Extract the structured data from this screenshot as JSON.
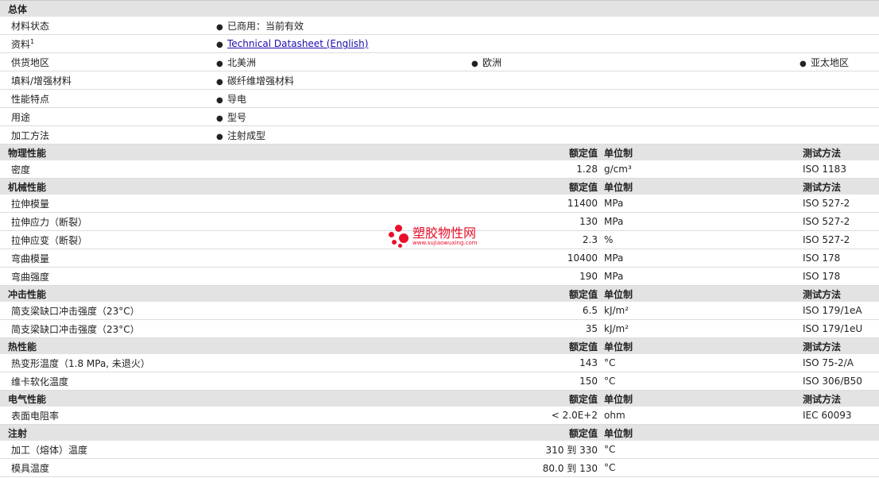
{
  "general": {
    "title": "总体",
    "rows": [
      {
        "label": "材料状态",
        "items": [
          "已商用：当前有效"
        ]
      },
      {
        "label": "资料",
        "sup": "1",
        "items": [
          "Technical Datasheet (English)"
        ],
        "link": true
      },
      {
        "label": "供货地区",
        "items": [
          "北美洲",
          "欧洲",
          "亚太地区"
        ]
      },
      {
        "label": "填料/增强材料",
        "items": [
          "碳纤维增强材料"
        ]
      },
      {
        "label": "性能特点",
        "items": [
          "导电"
        ]
      },
      {
        "label": "用途",
        "items": [
          "型号"
        ]
      },
      {
        "label": "加工方法",
        "items": [
          "注射成型"
        ]
      }
    ]
  },
  "sections": [
    {
      "title": "物理性能",
      "h_value": "额定值",
      "h_unit": "单位制",
      "h_method": "测试方法",
      "rows": [
        {
          "label": "密度",
          "value": "1.28",
          "unit": "g/cm³",
          "method": "ISO 1183"
        }
      ]
    },
    {
      "title": "机械性能",
      "h_value": "额定值",
      "h_unit": "单位制",
      "h_method": "测试方法",
      "rows": [
        {
          "label": "拉伸模量",
          "value": "11400",
          "unit": "MPa",
          "method": "ISO 527-2"
        },
        {
          "label": "拉伸应力（断裂）",
          "value": "130",
          "unit": "MPa",
          "method": "ISO 527-2"
        },
        {
          "label": "拉伸应变（断裂）",
          "value": "2.3",
          "unit": "%",
          "method": "ISO 527-2"
        },
        {
          "label": "弯曲模量",
          "value": "10400",
          "unit": "MPa",
          "method": "ISO 178"
        },
        {
          "label": "弯曲强度",
          "value": "190",
          "unit": "MPa",
          "method": "ISO 178"
        }
      ]
    },
    {
      "title": "冲击性能",
      "h_value": "额定值",
      "h_unit": "单位制",
      "h_method": "测试方法",
      "rows": [
        {
          "label": "简支梁缺口冲击强度（23°C）",
          "value": "6.5",
          "unit": "kJ/m²",
          "method": "ISO 179/1eA"
        },
        {
          "label": "简支梁缺口冲击强度（23°C）",
          "value": "35",
          "unit": "kJ/m²",
          "method": "ISO 179/1eU"
        }
      ]
    },
    {
      "title": "热性能",
      "h_value": "额定值",
      "h_unit": "单位制",
      "h_method": "测试方法",
      "rows": [
        {
          "label": "热变形温度（1.8 MPa, 未退火）",
          "value": "143",
          "unit": "°C",
          "method": "ISO 75-2/A"
        },
        {
          "label": "维卡软化温度",
          "value": "150",
          "unit": "°C",
          "method": "ISO 306/B50"
        }
      ]
    },
    {
      "title": "电气性能",
      "h_value": "额定值",
      "h_unit": "单位制",
      "h_method": "测试方法",
      "rows": [
        {
          "label": "表面电阻率",
          "value": "< 2.0E+2",
          "unit": "ohm",
          "method": "IEC 60093"
        }
      ]
    },
    {
      "title": "注射",
      "h_value": "额定值",
      "h_unit": "单位制",
      "h_method": "",
      "rows": [
        {
          "label": "加工（熔体）温度",
          "value": "310 到  330",
          "unit": "°C",
          "method": ""
        },
        {
          "label": "模具温度",
          "value": "80.0 到  130",
          "unit": "°C",
          "method": ""
        }
      ]
    }
  ],
  "watermark": {
    "title": "塑胶物性网",
    "url": "www.sujiaowuxing.com",
    "color": "#e8102a"
  }
}
